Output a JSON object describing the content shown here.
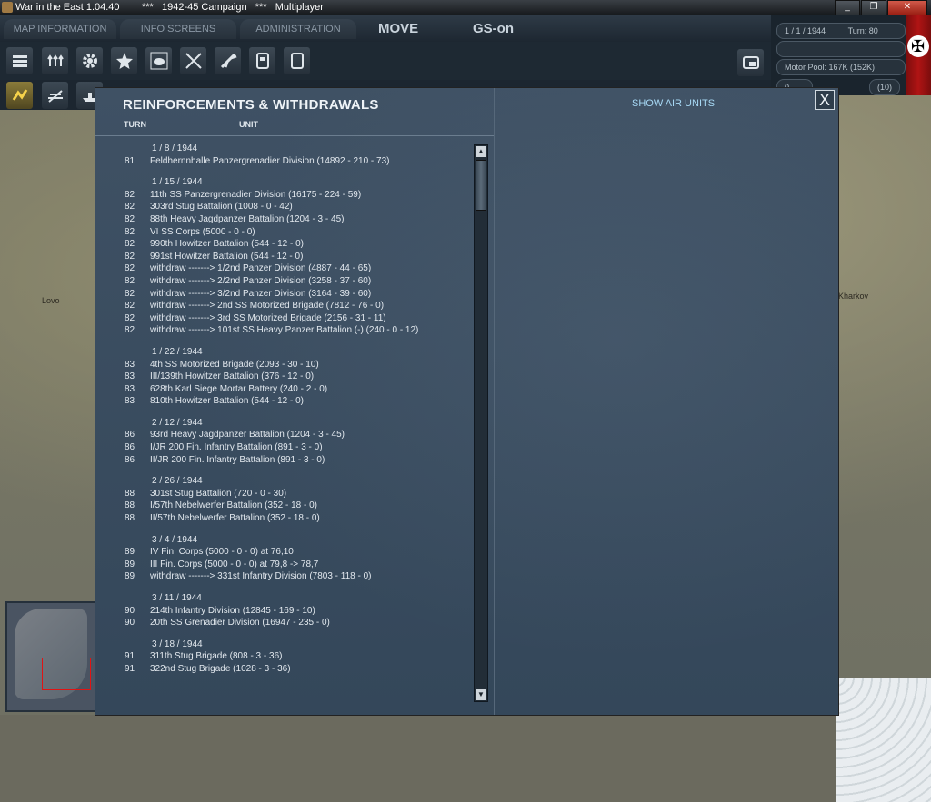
{
  "window": {
    "title": "War in the East 1.04.40        ***   1942-45 Campaign   ***   Multiplayer",
    "buttons": [
      "_",
      "❐",
      "✕"
    ]
  },
  "menu": {
    "tabs": [
      "MAP INFORMATION",
      "INFO SCREENS",
      "ADMINISTRATION"
    ],
    "mode": "MOVE",
    "gs": "GS-on"
  },
  "status": {
    "date": "1 / 1 / 1944",
    "turn": "Turn: 80",
    "motor_pool": "Motor Pool:  167K  (152K)",
    "counter_a": "0",
    "counter_b": "(10)"
  },
  "dialog": {
    "title": "REINFORCEMENTS & WITHDRAWALS",
    "col_turn": "TURN",
    "col_unit": "UNIT",
    "show_air_units": "SHOW AIR UNITS",
    "close": "X",
    "groups": [
      {
        "date": "1 / 8 / 1944",
        "rows": [
          {
            "turn": "81",
            "unit": "Feldhernnhalle Panzergrenadier Division  (14892 - 210 - 73)"
          }
        ]
      },
      {
        "date": "1 / 15 / 1944",
        "rows": [
          {
            "turn": "82",
            "unit": "11th SS Panzergrenadier Division  (16175 - 224 - 59)"
          },
          {
            "turn": "82",
            "unit": "303rd Stug Battalion  (1008 - 0 - 42)"
          },
          {
            "turn": "82",
            "unit": "88th Heavy Jagdpanzer Battalion  (1204 - 3 - 45)"
          },
          {
            "turn": "82",
            "unit": "VI SS Corps  (5000 - 0 - 0)"
          },
          {
            "turn": "82",
            "unit": "990th Howitzer Battalion  (544 - 12 - 0)"
          },
          {
            "turn": "82",
            "unit": "991st Howitzer Battalion  (544 - 12 - 0)"
          },
          {
            "turn": "82",
            "unit": "withdraw ------->  1/2nd Panzer Division  (4887 - 44 - 65)"
          },
          {
            "turn": "82",
            "unit": "withdraw ------->  2/2nd Panzer Division  (3258 - 37 - 60)"
          },
          {
            "turn": "82",
            "unit": "withdraw ------->  3/2nd Panzer Division  (3164 - 39 - 60)"
          },
          {
            "turn": "82",
            "unit": "withdraw ------->  2nd SS Motorized Brigade  (7812 - 76 - 0)"
          },
          {
            "turn": "82",
            "unit": "withdraw ------->  3rd SS Motorized Brigade  (2156 - 31 - 11)"
          },
          {
            "turn": "82",
            "unit": "withdraw ------->  101st SS Heavy Panzer Battalion (-)  (240 - 0 - 12)"
          }
        ]
      },
      {
        "date": "1 / 22 / 1944",
        "rows": [
          {
            "turn": "83",
            "unit": "4th SS Motorized Brigade  (2093 - 30 - 10)"
          },
          {
            "turn": "83",
            "unit": "III/139th Howitzer Battalion  (376 - 12 - 0)"
          },
          {
            "turn": "83",
            "unit": "628th Karl Siege Mortar Battery  (240 - 2 - 0)"
          },
          {
            "turn": "83",
            "unit": "810th Howitzer Battalion  (544 - 12 - 0)"
          }
        ]
      },
      {
        "date": "2 / 12 / 1944",
        "rows": [
          {
            "turn": "86",
            "unit": "93rd Heavy Jagdpanzer Battalion  (1204 - 3 - 45)"
          },
          {
            "turn": "86",
            "unit": "I/JR 200 Fin. Infantry Battalion  (891 - 3 - 0)"
          },
          {
            "turn": "86",
            "unit": "II/JR 200 Fin. Infantry Battalion  (891 - 3 - 0)"
          }
        ]
      },
      {
        "date": "2 / 26 / 1944",
        "rows": [
          {
            "turn": "88",
            "unit": "301st Stug Battalion  (720 - 0 - 30)"
          },
          {
            "turn": "88",
            "unit": "I/57th Nebelwerfer Battalion  (352 - 18 - 0)"
          },
          {
            "turn": "88",
            "unit": "II/57th Nebelwerfer Battalion  (352 - 18 - 0)"
          }
        ]
      },
      {
        "date": "3 / 4 / 1944",
        "rows": [
          {
            "turn": "89",
            "unit": "IV Fin. Corps  (5000 - 0 - 0) at 76,10"
          },
          {
            "turn": "89",
            "unit": "III Fin. Corps  (5000 - 0 - 0) at 79,8 -> 78,7"
          },
          {
            "turn": "89",
            "unit": "withdraw ------->  331st Infantry Division  (7803 - 118 - 0)"
          }
        ]
      },
      {
        "date": "3 / 11 / 1944",
        "rows": [
          {
            "turn": "90",
            "unit": "214th Infantry Division  (12845 - 169 - 10)"
          },
          {
            "turn": "90",
            "unit": "20th SS Grenadier Division  (16947 - 235 - 0)"
          }
        ]
      },
      {
        "date": "3 / 18 / 1944",
        "rows": [
          {
            "turn": "91",
            "unit": "311th Stug Brigade  (808 - 3 - 36)"
          },
          {
            "turn": "91",
            "unit": "322nd Stug Brigade  (1028 - 3 - 36)"
          }
        ]
      }
    ]
  },
  "map": {
    "towns": [
      "Lovo",
      "Kharkov"
    ]
  }
}
